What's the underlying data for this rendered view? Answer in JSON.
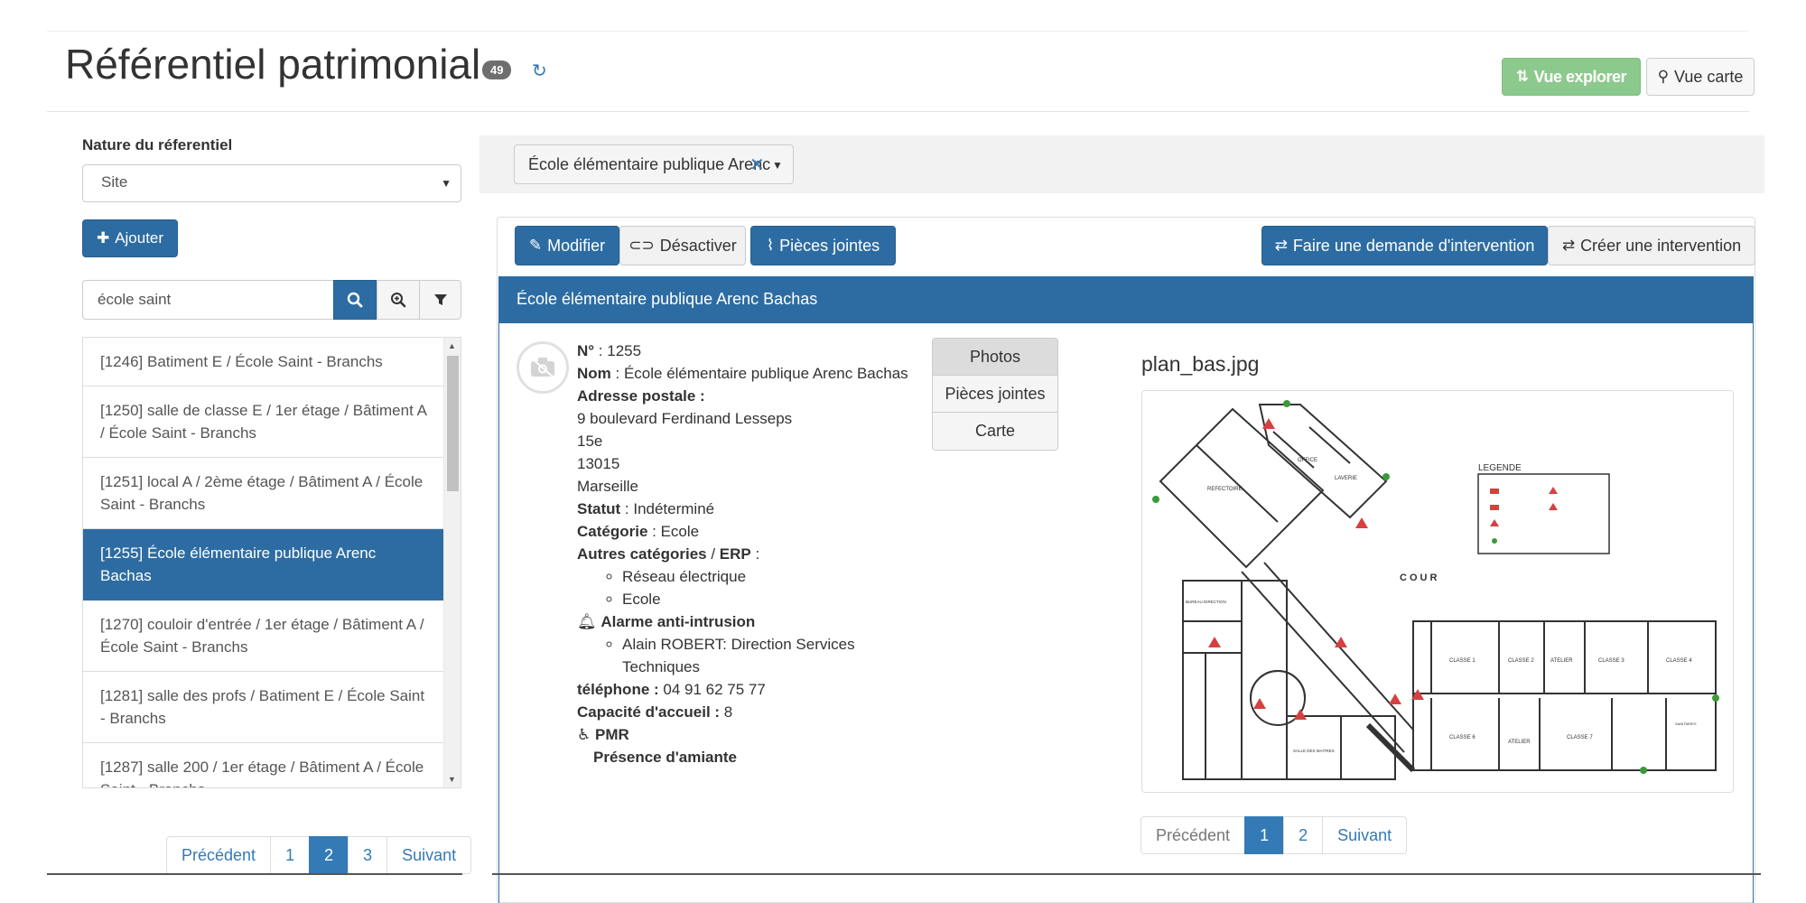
{
  "header": {
    "title": "Référentiel patrimonial",
    "count": "49",
    "btn_explorer": "Vue explorer",
    "btn_carte": "Vue carte"
  },
  "left": {
    "nature_label": "Nature du réferentiel",
    "nature_value": "Site",
    "add_label": "Ajouter",
    "search_value": "école saint",
    "items": [
      "[1246] Batiment E / École Saint - Branchs",
      "[1250] salle de classe E / 1er étage / Bâtiment A / École Saint - Branchs",
      "[1251] local A / 2ème étage / Bâtiment A / École Saint - Branchs",
      "[1255] École élémentaire publique Arenc Bachas",
      "[1270] couloir d'entrée / 1er étage / Bâtiment A / École Saint - Branchs",
      "[1281] salle des profs / Batiment E / École Saint - Branchs",
      "[1287] salle 200 / 1er étage / Bâtiment A / École Saint - Branchs"
    ],
    "pager": {
      "prev": "Précédent",
      "p1": "1",
      "p2": "2",
      "p3": "3",
      "next": "Suivant"
    }
  },
  "right": {
    "chip_label": "École élémentaire publique Arenc",
    "actions": {
      "modifier": "Modifier",
      "desactiver": "Désactiver",
      "pieces": "Pièces jointes",
      "demande": "Faire une demande d'intervention",
      "creer": "Créer une intervention"
    },
    "panel_title": "École élémentaire publique Arenc Bachas",
    "details": {
      "num_label": "N°",
      "num_value": " : 1255",
      "nom_label": "Nom",
      "nom_value": " : École élémentaire publique Arenc Bachas",
      "adresse_label": "Adresse postale :",
      "addr1": "9 boulevard Ferdinand Lesseps",
      "addr2": "15e",
      "addr3": "13015",
      "addr4": "Marseille",
      "statut_label": "Statut",
      "statut_value": " : Indéterminé",
      "categorie_label": "Catégorie",
      "categorie_value": " : Ecole",
      "autres_label": "Autres catégories",
      "autres_sep": " / ",
      "erp_label": "ERP",
      "autres_suffix": " :",
      "cat1": "Réseau électrique",
      "cat2": "Ecole",
      "alarme_label": "Alarme anti-intrusion",
      "alarme_item": "Alain ROBERT: Direction Services Techniques",
      "tel_label": "téléphone :",
      "tel_value": " 04 91 62 75 77",
      "capacite_label": "Capacité d'accueil :",
      "capacite_value": " 8",
      "pmr_label": "PMR",
      "amiante_label": "Présence d'amiante"
    },
    "tabs": [
      "Photos",
      "Pièces jointes",
      "Carte"
    ],
    "file_title": "plan_bas.jpg",
    "plan": {
      "refectoire": "REFECTOIRE",
      "office": "OFFICE",
      "laverie": "LAVERIE",
      "legende": "LEGENDE",
      "cour": "COUR",
      "classe1": "CLASSE 1",
      "classe2": "CLASSE 2",
      "atelier": "ATELIER",
      "classe3": "CLASSE 3",
      "classe4": "CLASSE 4",
      "classe6": "CLASSE 6",
      "classe7": "CLASSE 7",
      "bureau": "BUREAU DIRECTION",
      "salle_maitres": "SALLE DES MAITRES",
      "salle_union": "SALLE DE L'UNION",
      "sanitaires": "SANITAIRES"
    },
    "pager": {
      "prev": "Précédent",
      "p1": "1",
      "p2": "2",
      "next": "Suivant"
    }
  },
  "colors": {
    "primary": "#2d6ca2",
    "green": "#8cc98c",
    "link": "#337ab7"
  }
}
